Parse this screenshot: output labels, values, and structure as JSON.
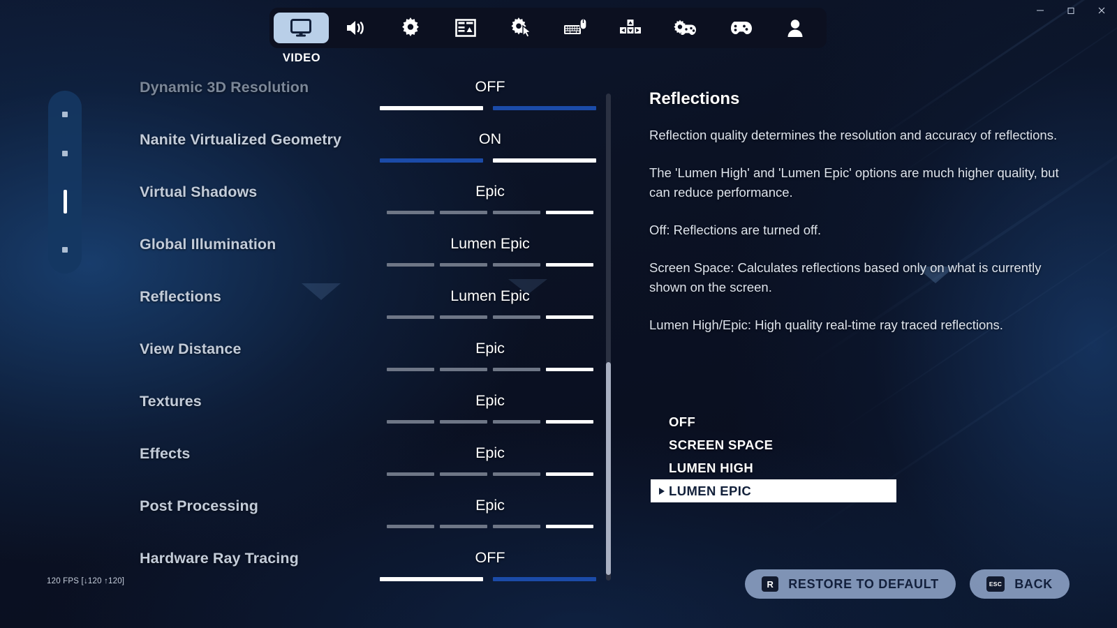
{
  "window": {
    "minimize_label": "minimize",
    "maximize_label": "maximize",
    "close_label": "close"
  },
  "tabbar": {
    "active_label": "VIDEO",
    "tabs": [
      {
        "icon": "monitor-icon",
        "name": "video",
        "active": true
      },
      {
        "icon": "speaker-icon",
        "name": "audio",
        "active": false
      },
      {
        "icon": "gear-icon",
        "name": "game",
        "active": false
      },
      {
        "icon": "hud-layout-icon",
        "name": "hud-layout",
        "active": false
      },
      {
        "icon": "gear-cursor-icon",
        "name": "accessibility",
        "active": false
      },
      {
        "icon": "keyboard-mouse-icon",
        "name": "keyboard-mouse",
        "active": false
      },
      {
        "icon": "dpad-icon",
        "name": "movement",
        "active": false
      },
      {
        "icon": "gear-controller-icon",
        "name": "controller-config",
        "active": false
      },
      {
        "icon": "controller-icon",
        "name": "controller",
        "active": false
      },
      {
        "icon": "account-icon",
        "name": "account",
        "active": false
      }
    ]
  },
  "pillnav": {
    "dots": [
      {
        "active": false
      },
      {
        "active": false
      },
      {
        "active": true
      },
      {
        "active": false
      }
    ]
  },
  "settings": {
    "rows": [
      {
        "label": "Dynamic 3D Resolution",
        "value": "OFF",
        "type": "toggle",
        "segments": [
          "white",
          "blue"
        ],
        "disabled": true
      },
      {
        "label": "Nanite Virtualized Geometry",
        "value": "ON",
        "type": "toggle",
        "segments": [
          "blue",
          "white"
        ],
        "disabled": false
      },
      {
        "label": "Virtual Shadows",
        "value": "Epic",
        "type": "quality",
        "segments": [
          "gray",
          "gray",
          "gray",
          "white"
        ],
        "disabled": false
      },
      {
        "label": "Global Illumination",
        "value": "Lumen Epic",
        "type": "quality",
        "segments": [
          "gray",
          "gray",
          "gray",
          "white"
        ],
        "disabled": false
      },
      {
        "label": "Reflections",
        "value": "Lumen Epic",
        "type": "quality",
        "segments": [
          "gray",
          "gray",
          "gray",
          "white"
        ],
        "disabled": false
      },
      {
        "label": "View Distance",
        "value": "Epic",
        "type": "quality",
        "segments": [
          "gray",
          "gray",
          "gray",
          "white"
        ],
        "disabled": false
      },
      {
        "label": "Textures",
        "value": "Epic",
        "type": "quality",
        "segments": [
          "gray",
          "gray",
          "gray",
          "white"
        ],
        "disabled": false
      },
      {
        "label": "Effects",
        "value": "Epic",
        "type": "quality",
        "segments": [
          "gray",
          "gray",
          "gray",
          "white"
        ],
        "disabled": false
      },
      {
        "label": "Post Processing",
        "value": "Epic",
        "type": "quality",
        "segments": [
          "gray",
          "gray",
          "gray",
          "white"
        ],
        "disabled": false
      },
      {
        "label": "Hardware Ray Tracing",
        "value": "OFF",
        "type": "toggle",
        "segments": [
          "white",
          "blue"
        ],
        "disabled": false
      }
    ]
  },
  "info": {
    "title": "Reflections",
    "paragraphs": [
      "Reflection quality determines the resolution and accuracy of reflections.",
      "The 'Lumen High' and 'Lumen Epic' options are much higher quality, but can reduce performance.",
      "Off: Reflections are turned off.",
      "Screen Space: Calculates reflections based only on what is currently shown on the screen.",
      "Lumen High/Epic: High quality real-time ray traced reflections."
    ],
    "options": [
      {
        "label": "OFF",
        "selected": false
      },
      {
        "label": "SCREEN SPACE",
        "selected": false
      },
      {
        "label": "LUMEN HIGH",
        "selected": false
      },
      {
        "label": "LUMEN EPIC",
        "selected": true
      }
    ]
  },
  "buttons": {
    "restore": {
      "key": "R",
      "label": "RESTORE TO DEFAULT"
    },
    "back": {
      "key": "ESC",
      "label": "BACK"
    }
  },
  "fps": {
    "text": "120 FPS [↓120 ↑120]"
  },
  "colors": {
    "accent_blue": "#1b4ba8",
    "active_tab_bg": "#b9cfe8",
    "selected_option_bg": "#ffffff",
    "segment_gray": "#6e7686",
    "button_bg": "rgba(156,178,214,.80)"
  }
}
